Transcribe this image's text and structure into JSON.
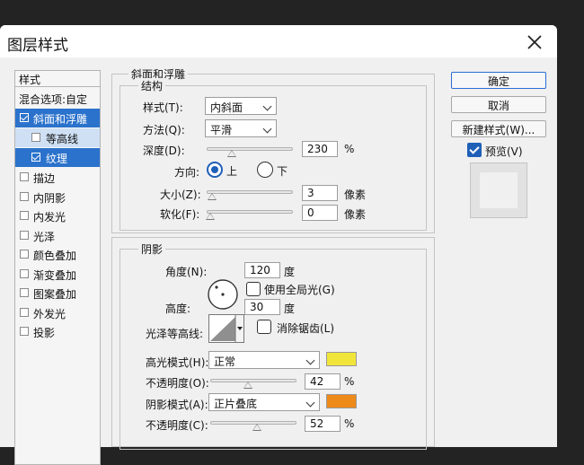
{
  "dialog": {
    "title": "图层样式"
  },
  "styles_panel": {
    "header": "样式",
    "blend_options": "混合选项:自定",
    "items": [
      {
        "label": "斜面和浮雕",
        "checked": true
      },
      {
        "label": "等高线",
        "checked": false
      },
      {
        "label": "纹理",
        "checked": true
      },
      {
        "label": "描边",
        "checked": false
      },
      {
        "label": "内阴影",
        "checked": false
      },
      {
        "label": "内发光",
        "checked": false
      },
      {
        "label": "光泽",
        "checked": false
      },
      {
        "label": "颜色叠加",
        "checked": false
      },
      {
        "label": "渐变叠加",
        "checked": false
      },
      {
        "label": "图案叠加",
        "checked": false
      },
      {
        "label": "外发光",
        "checked": false
      },
      {
        "label": "投影",
        "checked": false
      }
    ]
  },
  "bevel": {
    "group_title": "斜面和浮雕",
    "structure_title": "结构",
    "style_label": "样式(T):",
    "style_value": "内斜面",
    "technique_label": "方法(Q):",
    "technique_value": "平滑",
    "depth_label": "深度(D):",
    "depth_value": "230",
    "depth_unit": "%",
    "depth_fraction": 0.23,
    "direction_label": "方向:",
    "direction_up": "上",
    "direction_down": "下",
    "direction_selected": "up",
    "size_label": "大小(Z):",
    "size_value": "3",
    "size_unit": "像素",
    "soften_label": "软化(F):",
    "soften_value": "0",
    "soften_unit": "像素"
  },
  "shading": {
    "group_title": "阴影",
    "angle_label": "角度(N):",
    "angle_value": "120",
    "angle_unit": "度",
    "global_light_label": "使用全局光(G)",
    "altitude_label": "高度:",
    "altitude_value": "30",
    "altitude_unit": "度",
    "gloss_contour_label": "光泽等高线:",
    "anti_aliased_label": "消除锯齿(L)",
    "highlight_mode_label": "高光模式(H):",
    "highlight_mode_value": "正常",
    "highlight_color": "#f2e53a",
    "highlight_opacity_label": "不透明度(O):",
    "highlight_opacity_value": "42",
    "highlight_opacity_unit": "%",
    "shadow_mode_label": "阴影模式(A):",
    "shadow_mode_value": "正片叠底",
    "shadow_color": "#ee8a1a",
    "shadow_opacity_label": "不透明度(C):",
    "shadow_opacity_value": "52",
    "shadow_opacity_unit": "%"
  },
  "actions": {
    "ok": "确定",
    "cancel": "取消",
    "new_style": "新建样式(W)...",
    "preview": "预览(V)"
  },
  "colors": {
    "accent": "#2b72cc",
    "sub_highlight": "#cfe0f5"
  }
}
